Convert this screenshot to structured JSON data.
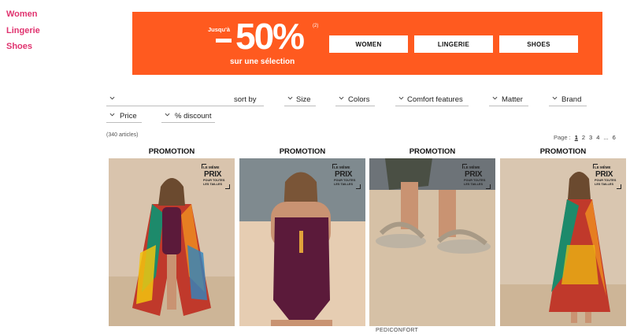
{
  "nav": {
    "items": [
      "Women",
      "Lingerie",
      "Shoes"
    ]
  },
  "banner": {
    "prefix": "Jusqu'à",
    "discount": "50%",
    "footnote": "(2)",
    "subtitle": "sur une sélection",
    "buttons": [
      "WOMEN",
      "LINGERIE",
      "SHOES"
    ]
  },
  "filters": {
    "sort": "sort by",
    "items": [
      "Size",
      "Colors",
      "Comfort features",
      "Matter",
      "Brand",
      "Price",
      "% discount"
    ]
  },
  "results": {
    "count": "(340 articles)"
  },
  "pagination": {
    "label": "Page :",
    "pages": [
      "1",
      "2",
      "3",
      "4",
      "...",
      "6"
    ],
    "current": "1"
  },
  "badge": {
    "line1": "LE MÊME",
    "line2": "PRIX",
    "line3": "POUR TOUTES LES TAILLES"
  },
  "products": [
    {
      "tag": "PROMOTION"
    },
    {
      "tag": "PROMOTION"
    },
    {
      "tag": "PROMOTION",
      "brand": "PEDICONFORT"
    },
    {
      "tag": "PROMOTION"
    }
  ],
  "colors": {
    "accent": "#e0336f",
    "banner": "#ff5a1f",
    "swim": "#5b1a3a"
  },
  "icons": {
    "filter_toggle": "chevron-down-icon"
  }
}
